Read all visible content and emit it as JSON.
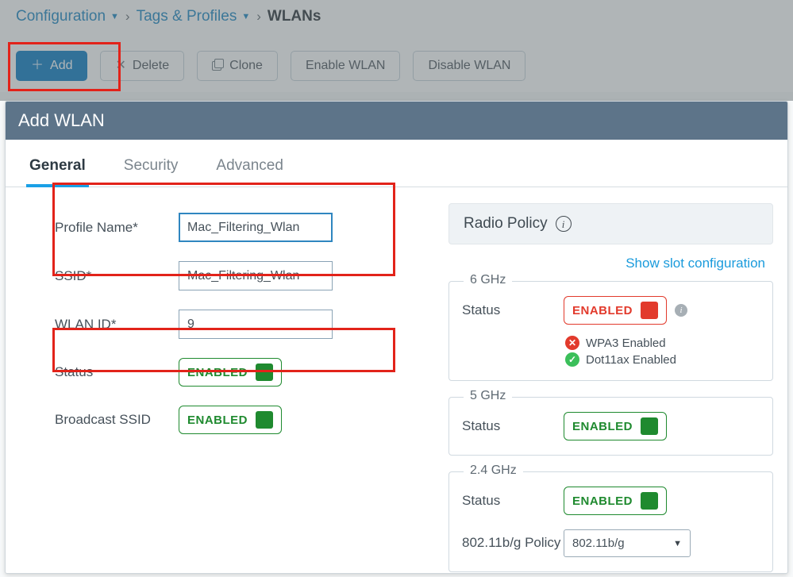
{
  "breadcrumb": {
    "item1": "Configuration",
    "item2": "Tags & Profiles",
    "current": "WLANs"
  },
  "toolbar": {
    "add": "Add",
    "delete": "Delete",
    "clone": "Clone",
    "enable": "Enable WLAN",
    "disable": "Disable WLAN"
  },
  "modal": {
    "title": "Add WLAN",
    "tabs": {
      "general": "General",
      "security": "Security",
      "advanced": "Advanced"
    },
    "left": {
      "profile_name_label": "Profile Name*",
      "profile_name_value": "Mac_Filtering_Wlan",
      "ssid_label": "SSID*",
      "ssid_value": "Mac_Filtering_Wlan",
      "wlan_id_label": "WLAN ID*",
      "wlan_id_value": "9",
      "status_label": "Status",
      "status_value": "ENABLED",
      "broadcast_label": "Broadcast SSID",
      "broadcast_value": "ENABLED"
    },
    "right": {
      "radio_policy_label": "Radio Policy",
      "slot_link": "Show slot configuration",
      "band6": {
        "title": "6 GHz",
        "status_label": "Status",
        "status_value": "ENABLED",
        "wpa3_label": "WPA3 Enabled",
        "dot11ax_label": "Dot11ax Enabled"
      },
      "band5": {
        "title": "5 GHz",
        "status_label": "Status",
        "status_value": "ENABLED"
      },
      "band24": {
        "title": "2.4 GHz",
        "status_label": "Status",
        "status_value": "ENABLED",
        "policy_label": "802.11b/g Policy",
        "policy_value": "802.11b/g"
      }
    }
  }
}
